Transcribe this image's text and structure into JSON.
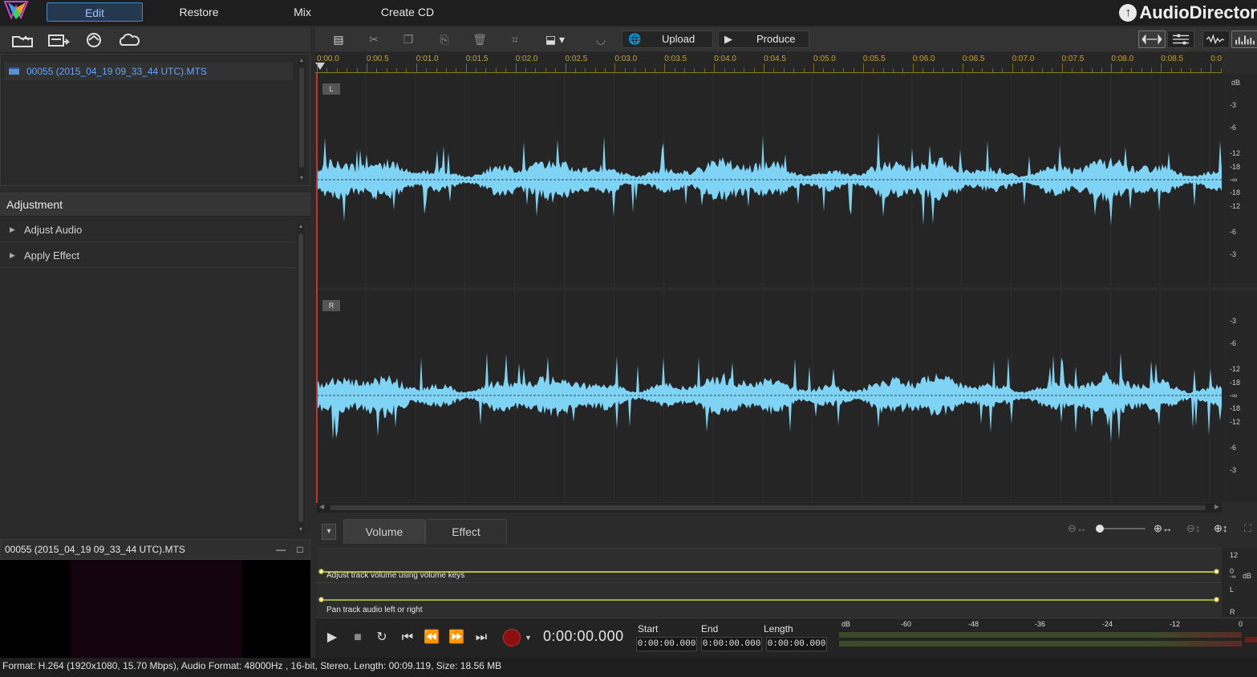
{
  "app": {
    "brand": "AudioDirector",
    "modes": [
      {
        "label": "Edit",
        "active": true
      },
      {
        "label": "Restore",
        "active": false
      },
      {
        "label": "Mix",
        "active": false
      },
      {
        "label": "Create CD",
        "active": false
      }
    ]
  },
  "library": {
    "toolbar_icons": [
      "import-media-icon",
      "export-library-icon",
      "sync-icon",
      "cloud-icon"
    ],
    "files": [
      {
        "name": "00055 (2015_04_19 09_33_44 UTC).MTS",
        "selected": true
      }
    ]
  },
  "adjustment": {
    "title": "Adjustment",
    "items": [
      "Adjust Audio",
      "Apply Effect"
    ]
  },
  "preview": {
    "title": "00055 (2015_04_19 09_33_44 UTC).MTS",
    "minimize": "—",
    "maximize": "□"
  },
  "toolbar": {
    "upload_label": "Upload",
    "produce_label": "Produce",
    "icons": [
      "new-file-icon",
      "cut-icon",
      "copy-icon",
      "paste-icon",
      "delete-icon",
      "crop-icon",
      "insert-marker-icon",
      "denoise-icon",
      "globe-icon",
      "produce-icon",
      "stereo-view-icon",
      "track-view-icon",
      "waveform-view-icon",
      "spectrum-view-icon"
    ]
  },
  "ruler": {
    "labels": [
      "0:00.0",
      "0:00.5",
      "0:01.0",
      "0:01.5",
      "0:02.0",
      "0:02.5",
      "0:03.0",
      "0:03.5",
      "0:04.0",
      "0:04.5",
      "0:05.0",
      "0:05.5",
      "0:06.0",
      "0:06.5",
      "0:07.0",
      "0:07.5",
      "0:08.0",
      "0:08.5",
      "0:0"
    ]
  },
  "channels": [
    {
      "label": "L",
      "db_labels": [
        "dB",
        "-3",
        "-6",
        "-12",
        "-18",
        "-∞",
        "-18",
        "-12",
        "-6",
        "-3"
      ]
    },
    {
      "label": "R",
      "db_labels": [
        "-3",
        "-6",
        "-12",
        "-18",
        "-∞",
        "-18",
        "-12",
        "-6",
        "-3"
      ]
    }
  ],
  "waveform_color": "#7fd3f5",
  "tabs": [
    {
      "label": "Volume",
      "active": true
    },
    {
      "label": "Effect",
      "active": false
    }
  ],
  "lanes": {
    "volume_text": "Adjust track volume using volume keys",
    "pan_text": "Pan track audio left or right",
    "scale": {
      "top": "12",
      "zero": "0",
      "unit": "dB",
      "neg": "-∞",
      "left": "L",
      "right": "R"
    }
  },
  "transport": {
    "timecode": "0:00:00.000",
    "start_label": "Start",
    "end_label": "End",
    "length_label": "Length",
    "start_value": "0:00:00.000",
    "end_value": "0:00:00.000",
    "length_value": "0:00:00.000",
    "meter_labels": [
      "dB",
      "-60",
      "-48",
      "-36",
      "-24",
      "-12",
      "0"
    ]
  },
  "status": {
    "text": "Format: H.264 (1920x1080, 15.70 Mbps), Audio Format: 48000Hz , 16-bit, Stereo, Length: 00:09.119, Size: 18.56 MB"
  }
}
